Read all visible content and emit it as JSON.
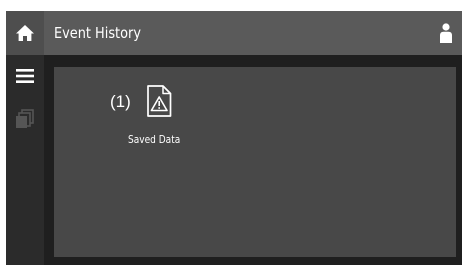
{
  "header": {
    "title": "Event History"
  },
  "sidebar": {
    "items": [
      {
        "icon": "home-icon"
      },
      {
        "icon": "menu-icon"
      },
      {
        "icon": "documents-icon"
      }
    ]
  },
  "user": {
    "icon": "user-icon"
  },
  "events": [
    {
      "count": "(1)",
      "icon": "warning-document-icon",
      "label": "Saved Data"
    }
  ],
  "colors": {
    "header_bg": "#5a5a5a",
    "sidebar_bg": "#2b2b2b",
    "home_bg": "#4e4e4e",
    "panel_bg": "#484848",
    "text": "#ffffff",
    "inactive_icon": "#555555"
  }
}
